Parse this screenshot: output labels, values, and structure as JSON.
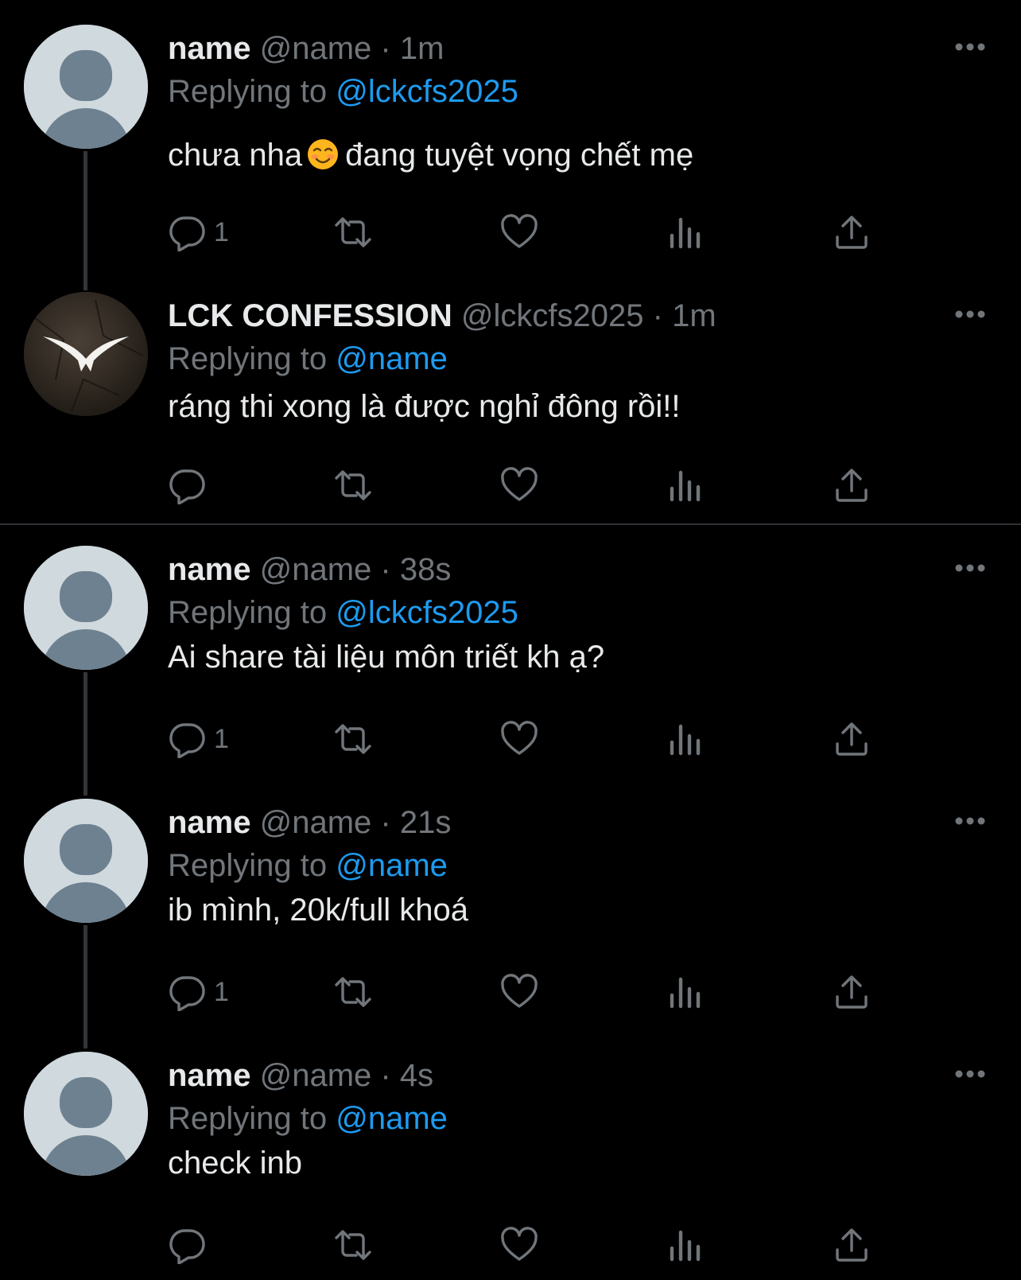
{
  "tweets": [
    {
      "name": "name",
      "handle": "@name",
      "sep": "·",
      "time": "1m",
      "replying_prefix": "Replying to",
      "replying_to": "@lckcfs2025",
      "text_before": "chưa nha",
      "emoji": "smiling-face-emoji",
      "text_after": "đang tuyệt vọng chết mẹ",
      "reply_count": "1"
    },
    {
      "name": "LCK CONFESSION",
      "handle": "@lckcfs2025",
      "sep": "·",
      "time": "1m",
      "replying_prefix": "Replying to",
      "replying_to": "@name",
      "text": "ráng thi xong là được nghỉ đông rồi!!",
      "reply_count": ""
    },
    {
      "name": "name",
      "handle": "@name",
      "sep": "·",
      "time": "38s",
      "replying_prefix": "Replying to",
      "replying_to": "@lckcfs2025",
      "text": "Ai share tài liệu môn triết kh ạ?",
      "reply_count": "1"
    },
    {
      "name": "name",
      "handle": "@name",
      "sep": "·",
      "time": "21s",
      "replying_prefix": "Replying to",
      "replying_to": "@name",
      "text": "ib mình, 20k/full khoá",
      "reply_count": "1"
    },
    {
      "name": "name",
      "handle": "@name",
      "sep": "·",
      "time": "4s",
      "replying_prefix": "Replying to",
      "replying_to": "@name",
      "text": "check inb",
      "reply_count": ""
    }
  ],
  "icons": {
    "reply": "reply-icon",
    "retweet": "retweet-icon",
    "like": "heart-icon",
    "views": "views-icon",
    "share": "share-icon",
    "more": "more-icon"
  },
  "colors": {
    "background": "#000000",
    "text": "#e7e9ea",
    "secondary": "#71767b",
    "accent": "#1d9bf0",
    "avatar_bg": "#cfd9de",
    "avatar_fg": "#6e8190"
  }
}
